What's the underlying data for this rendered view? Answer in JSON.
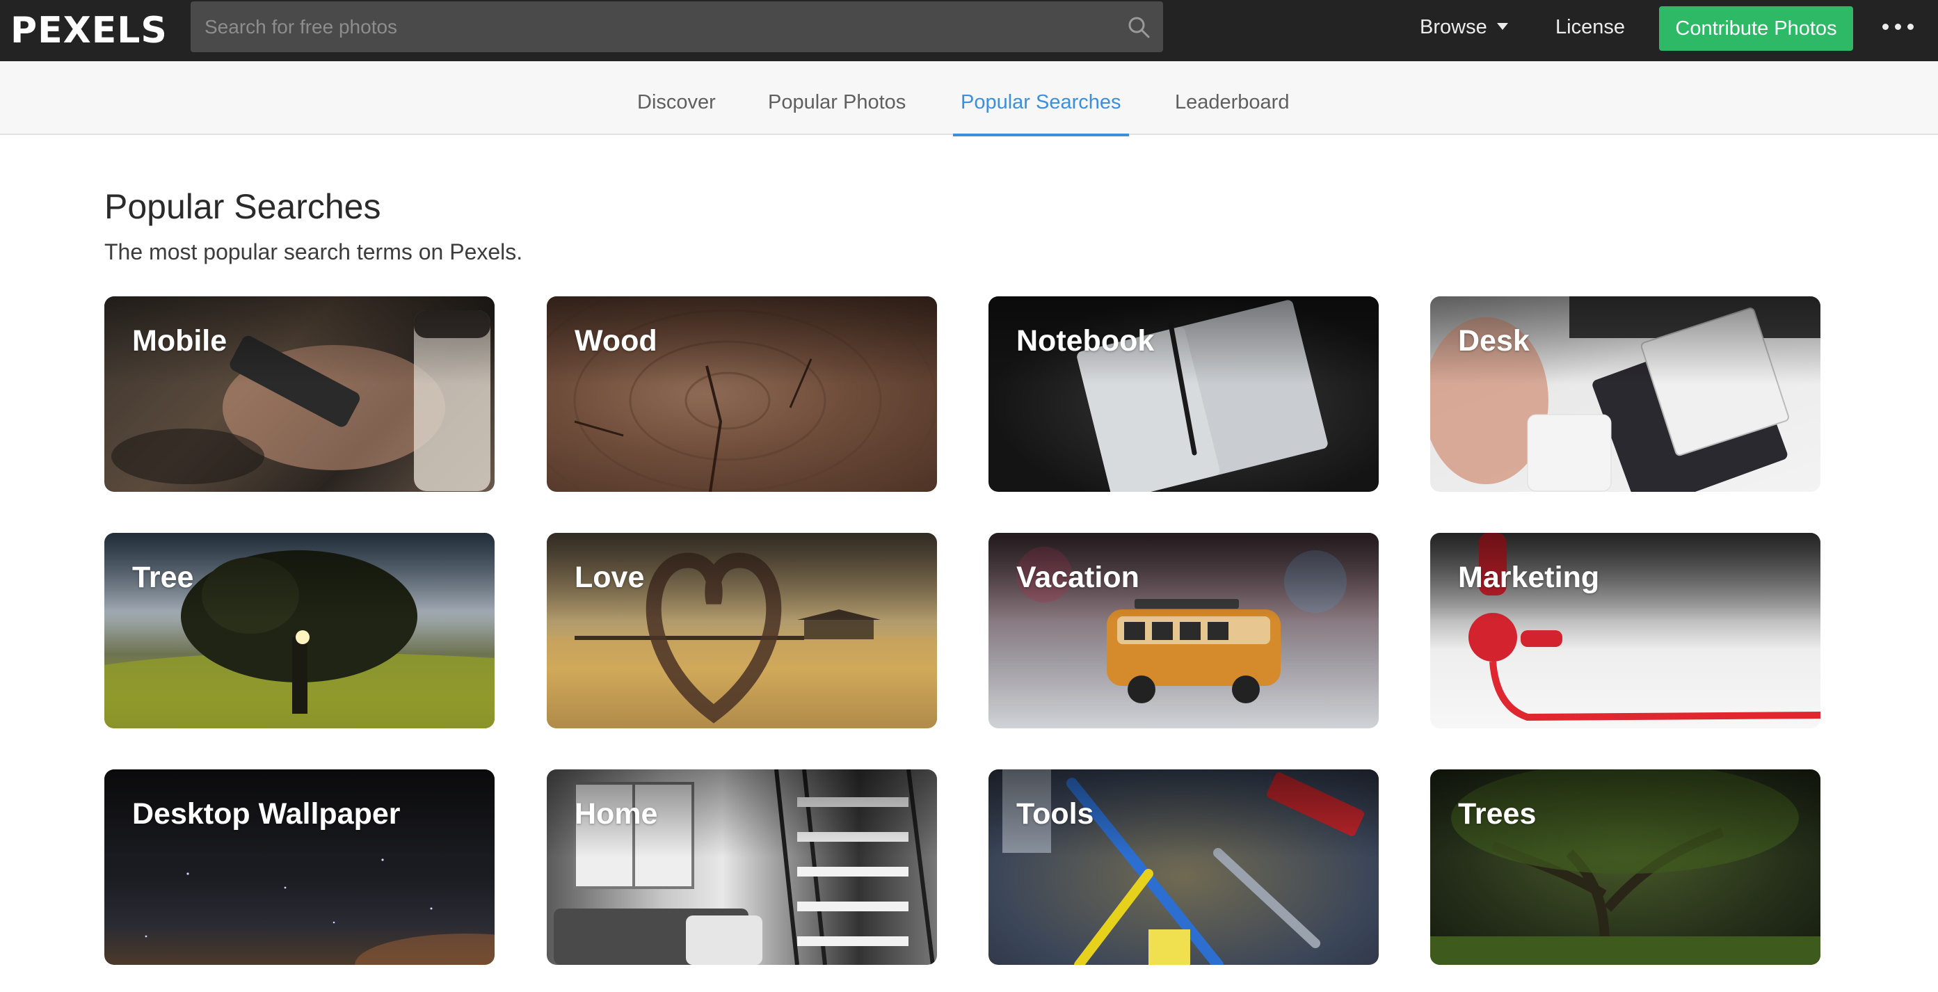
{
  "header": {
    "logo": "PEXELS",
    "search_placeholder": "Search for free photos",
    "browse_label": "Browse",
    "license_label": "License",
    "contribute_label": "Contribute Photos",
    "accent_green": "#2eb967"
  },
  "subnav": {
    "tabs": [
      {
        "label": "Discover",
        "active": false
      },
      {
        "label": "Popular Photos",
        "active": false
      },
      {
        "label": "Popular Searches",
        "active": true
      },
      {
        "label": "Leaderboard",
        "active": false
      }
    ],
    "active_color": "#3e8fdb"
  },
  "main": {
    "title": "Popular Searches",
    "subtitle": "The most popular search terms on Pexels.",
    "tiles": [
      {
        "label": "Mobile"
      },
      {
        "label": "Wood"
      },
      {
        "label": "Notebook"
      },
      {
        "label": "Desk"
      },
      {
        "label": "Tree"
      },
      {
        "label": "Love"
      },
      {
        "label": "Vacation"
      },
      {
        "label": "Marketing"
      },
      {
        "label": "Desktop Wallpaper"
      },
      {
        "label": "Home"
      },
      {
        "label": "Tools"
      },
      {
        "label": "Trees"
      }
    ]
  }
}
